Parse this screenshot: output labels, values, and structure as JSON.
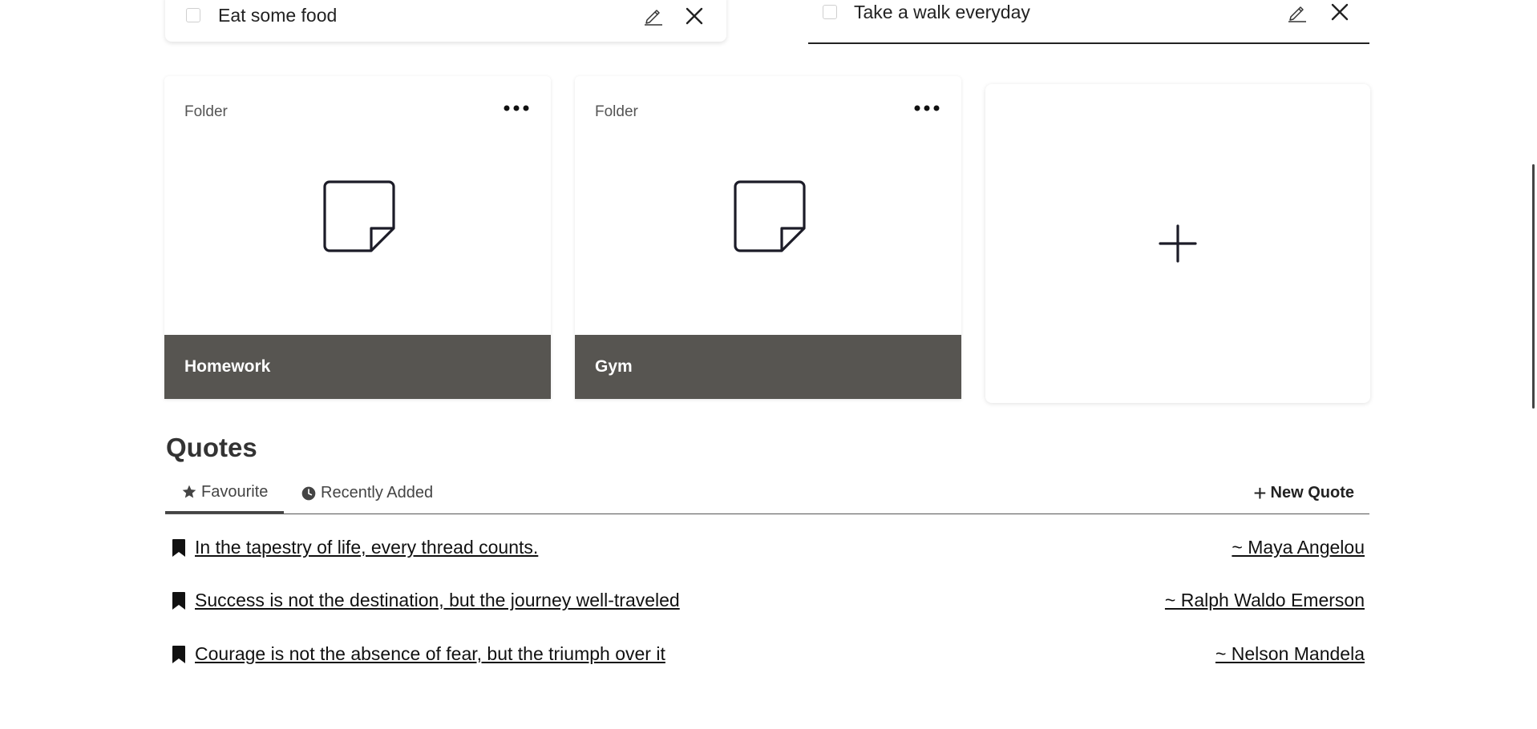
{
  "tasks": [
    {
      "text": "Eat some food",
      "checked": false
    },
    {
      "text": "Take a walk everyday",
      "checked": false
    }
  ],
  "folders": [
    {
      "label": "Folder",
      "name": "Homework"
    },
    {
      "label": "Folder",
      "name": "Gym"
    }
  ],
  "colors": {
    "folder_footer": "#575551",
    "text_primary": "#222222"
  },
  "quotes": {
    "title": "Quotes",
    "tabs": [
      {
        "label": "Favourite",
        "icon": "star-icon",
        "active": true
      },
      {
        "label": "Recently Added",
        "icon": "clock-icon",
        "active": false
      }
    ],
    "new_quote_label": "New Quote",
    "new_quote_plus": "+",
    "items": [
      {
        "text": "In the tapestry of life, every thread counts.",
        "author": "~ Maya Angelou"
      },
      {
        "text": "Success is not the destination, but the journey well-traveled",
        "author": "~ Ralph Waldo Emerson"
      },
      {
        "text": "Courage is not the absence of fear, but the triumph over it",
        "author": "~ Nelson Mandela"
      }
    ]
  }
}
